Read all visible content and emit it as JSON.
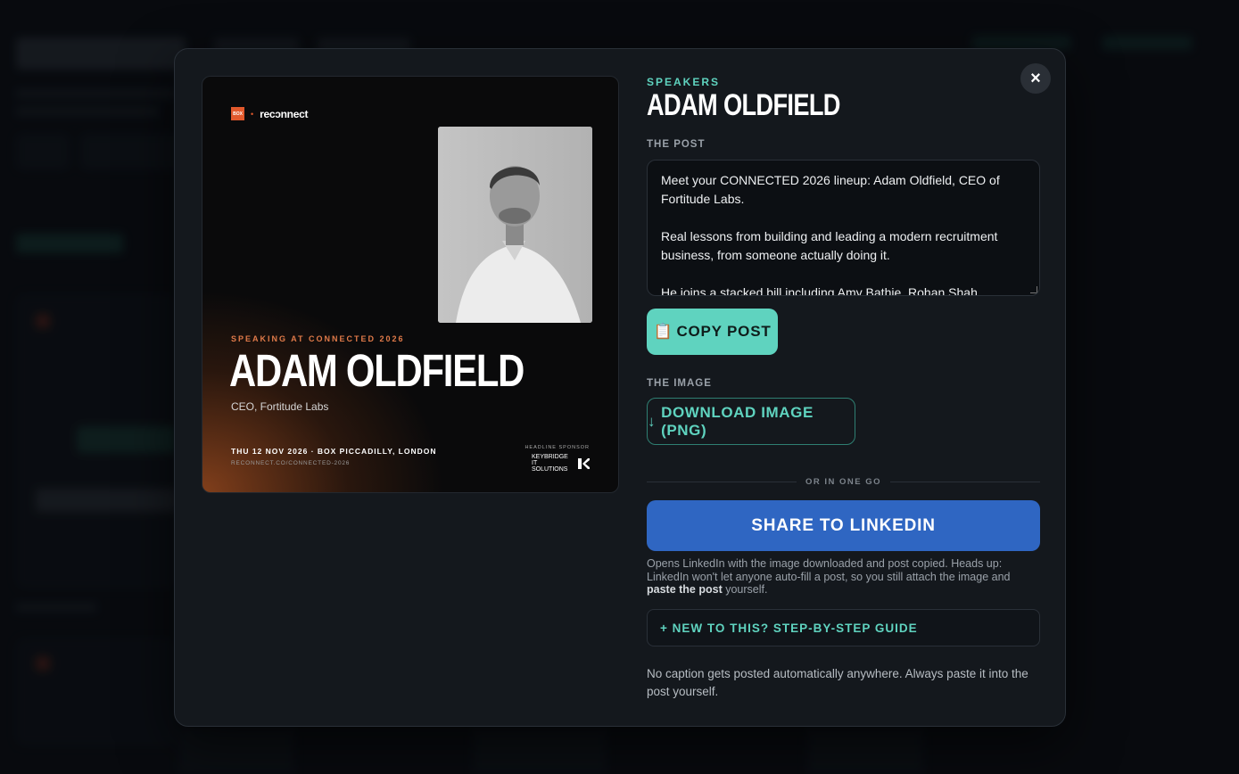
{
  "modal": {
    "close_label": "×",
    "eyebrow": "SPEAKERS",
    "speaker_name": "ADAM OLDFIELD",
    "post_section_label": "THE POST",
    "post_text": "Meet your CONNECTED 2026 lineup: Adam Oldfield, CEO of Fortitude Labs.\n\nReal lessons from building and leading a modern recruitment business, from someone actually doing it.\n\nHe joins a stacked bill including Amy Bathie, Rohan Shah,",
    "copy_icon": "📋",
    "copy_label": "COPY POST",
    "image_section_label": "THE IMAGE",
    "download_icon": "↓",
    "download_label": "DOWNLOAD IMAGE (PNG)",
    "divider_text": "OR IN ONE GO",
    "share_label": "SHARE TO LINKEDIN",
    "note_part1": "Opens LinkedIn with the image downloaded and post copied. Heads up: LinkedIn won't let anyone auto-fill a post, so you still attach the image and ",
    "note_bold": "paste the post",
    "note_part2": " yourself.",
    "guide_label": "+ NEW TO THIS? STEP-BY-STEP GUIDE",
    "footer_text": "No caption gets posted automatically anywhere. Always paste it into the post yourself."
  },
  "preview": {
    "box_logo_text": "BOX",
    "separator": "•",
    "brand": "recɔnnect",
    "kicker": "SPEAKING AT CONNECTED 2026",
    "name": "ADAM OLDFIELD",
    "role": "CEO, Fortitude Labs",
    "date_venue": "THU 12 NOV 2026 · BOX PICCADILLY, LONDON",
    "url": "RECONNECT.CO/CONNECTED-2026",
    "sponsor_label": "HEADLINE SPONSOR",
    "sponsor_name": "KEYBRIDGE IT SOLUTIONS"
  },
  "colors": {
    "accent_teal": "#5fd3bf",
    "linkedin_blue": "#2f66c2",
    "modal_bg": "#14181d",
    "preview_orange": "#e07a49"
  }
}
